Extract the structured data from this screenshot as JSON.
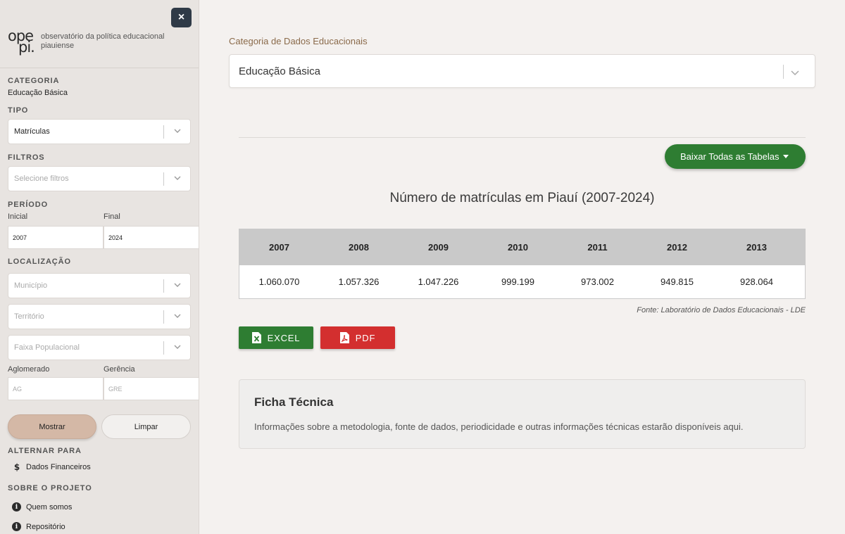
{
  "sidebar": {
    "close_icon": "×",
    "logo": {
      "line1": "ope",
      "line2": "pi.",
      "text_line1": "observatório da política educacional",
      "text_line2": "piauiense"
    },
    "categoria": {
      "title": "CATEGORIA",
      "value": "Educação Básica"
    },
    "tipo": {
      "title": "TIPO",
      "value": "Matrículas"
    },
    "filtros": {
      "title": "FILTROS",
      "placeholder": "Selecione filtros"
    },
    "periodo": {
      "title": "PERÍODO",
      "inicial_label": "Inicial",
      "final_label": "Final",
      "inicial_value": "2007",
      "final_value": "2024"
    },
    "localizacao": {
      "title": "LOCALIZAÇÃO",
      "municipio": "Município",
      "territorio": "Território",
      "faixa": "Faixa Populacional",
      "aglomerado_label": "Aglomerado",
      "gerencia_label": "Gerência",
      "aglomerado_ph": "AG",
      "gerencia_ph": "GRE"
    },
    "buttons": {
      "mostrar": "Mostrar",
      "limpar": "Limpar"
    },
    "alternar": {
      "title": "ALTERNAR PARA",
      "item": "Dados Financeiros"
    },
    "sobre": {
      "title": "SOBRE O PROJETO",
      "items": [
        "Quem somos",
        "Repositório"
      ]
    }
  },
  "main": {
    "category_label": "Categoria de Dados Educacionais",
    "category_value": "Educação Básica",
    "download_all": "Baixar Todas as Tabelas",
    "table_title": "Número de matrículas em Piauí (2007-2024)",
    "table": {
      "headers": [
        "2007",
        "2008",
        "2009",
        "2010",
        "2011",
        "2012",
        "2013"
      ],
      "values": [
        "1.060.070",
        "1.057.326",
        "1.047.226",
        "999.199",
        "973.002",
        "949.815",
        "928.064"
      ]
    },
    "source": "Fonte: Laboratório de Dados Educacionais - LDE",
    "excel": "EXCEL",
    "pdf": "PDF",
    "ficha": {
      "title": "Ficha Técnica",
      "text": "Informações sobre a metodologia, fonte de dados, periodicidade e outras informações técnicas estarão disponíveis aqui."
    }
  },
  "colors": {
    "green": "#2e7d32",
    "red": "#d32f2f",
    "sidebar_bg": "#e8e4e1",
    "main_bg": "#f4f1ef",
    "mostrar": "#d4b8a6"
  }
}
